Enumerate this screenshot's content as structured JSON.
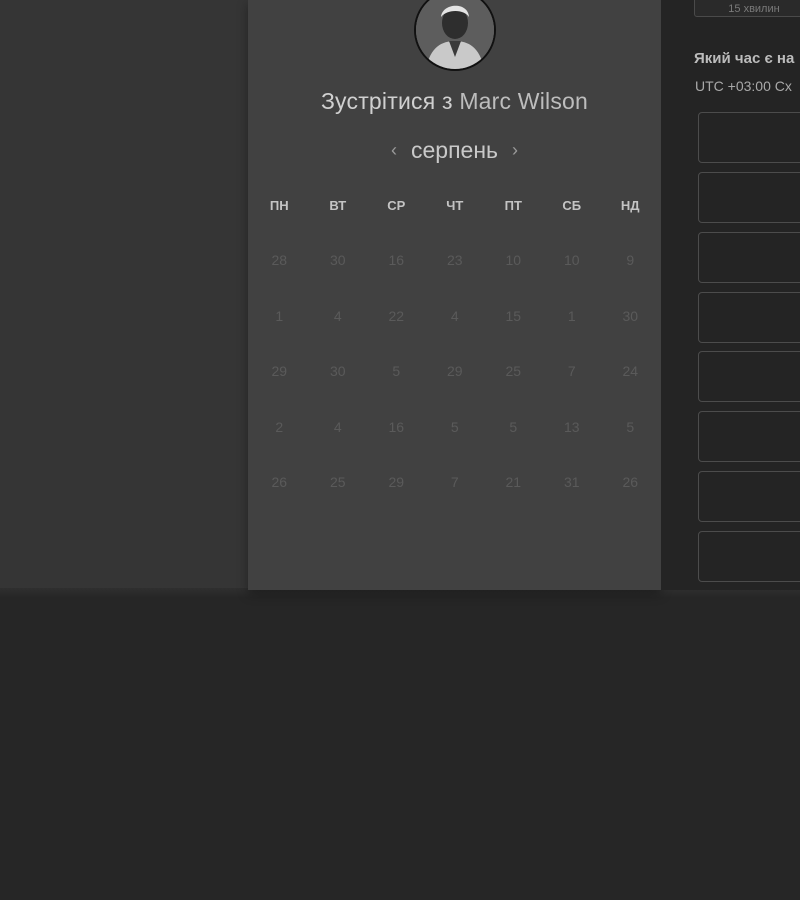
{
  "scheduler": {
    "title_prefix": "Зустрітися з",
    "host_name": "Marc Wilson",
    "prev_month_label": "‹",
    "next_month_label": "›",
    "month_label": "серпень",
    "weekdays": [
      "ПН",
      "ВТ",
      "СР",
      "ЧТ",
      "ПТ",
      "СБ",
      "НД"
    ],
    "days": [
      [
        "28",
        "30",
        "16",
        "23",
        "10",
        "10",
        "9"
      ],
      [
        "1",
        "4",
        "22",
        "4",
        "15",
        "1",
        "30"
      ],
      [
        "29",
        "30",
        "5",
        "29",
        "25",
        "7",
        "24"
      ],
      [
        "2",
        "4",
        "16",
        "5",
        "5",
        "13",
        "5"
      ],
      [
        "26",
        "25",
        "29",
        "7",
        "21",
        "31",
        "26"
      ]
    ]
  },
  "side": {
    "duration_label": "15 хвилин",
    "question": "Який час є на",
    "timezone": "UTC +03:00 Сх"
  },
  "colors": {
    "card": "#414141",
    "page": "#262626",
    "side": "#242424"
  }
}
